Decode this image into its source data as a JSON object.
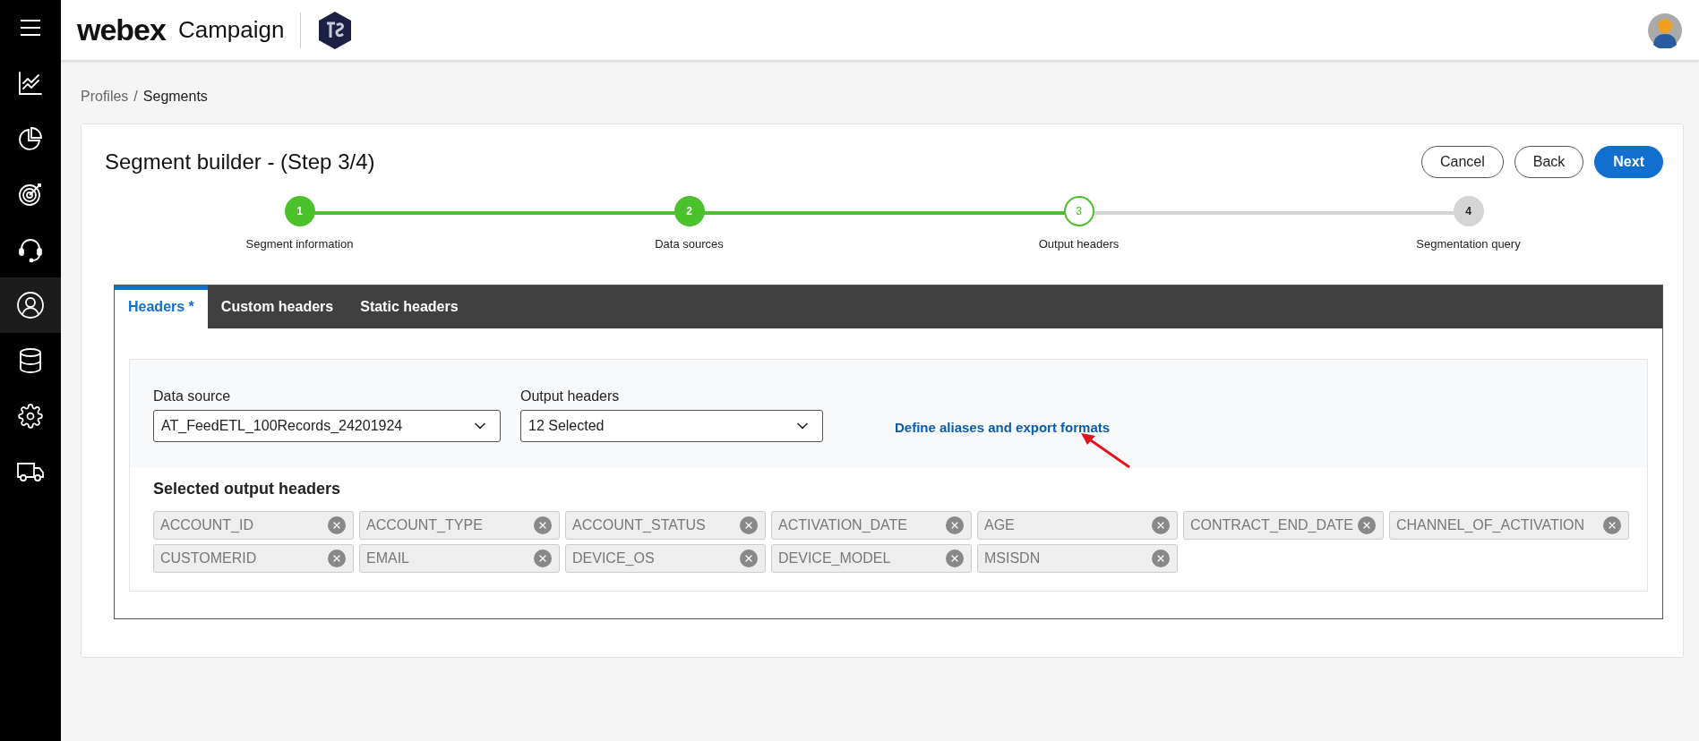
{
  "app": {
    "brand": "webex",
    "product": "Campaign"
  },
  "sidebar": {
    "items": [
      {
        "selected": false
      },
      {
        "selected": false
      },
      {
        "selected": false
      },
      {
        "selected": false
      },
      {
        "selected": true
      },
      {
        "selected": false
      },
      {
        "selected": false
      },
      {
        "selected": false
      }
    ]
  },
  "breadcrumb": {
    "separator": "/",
    "items": [
      {
        "label": "Profiles",
        "current": false
      },
      {
        "label": "Segments",
        "current": true
      }
    ]
  },
  "page_title": "Segment builder - (Step 3/4)",
  "buttons": [
    {
      "label": "Cancel",
      "kind": "outline"
    },
    {
      "label": "Back",
      "kind": "outline"
    },
    {
      "label": "Next",
      "kind": "primary"
    }
  ],
  "steps": [
    {
      "number": "1",
      "label": "Segment information",
      "completed": true,
      "selected": false
    },
    {
      "number": "2",
      "label": "Data sources",
      "completed": true,
      "selected": false
    },
    {
      "number": "3",
      "label": "Output headers",
      "completed": false,
      "selected": true
    },
    {
      "number": "4",
      "label": "Segmentation query",
      "completed": false,
      "selected": false
    }
  ],
  "tabs": [
    {
      "label": "Headers *",
      "selected": true
    },
    {
      "label": "Custom headers",
      "selected": false
    },
    {
      "label": "Static headers",
      "selected": false
    }
  ],
  "form": {
    "data_source": {
      "label": "Data source",
      "value": "AT_FeedETL_100Records_24201924"
    },
    "output_headers": {
      "label": "Output headers",
      "value": "12 Selected"
    },
    "link": "Define aliases and export formats"
  },
  "selected_headers": {
    "title": "Selected output headers",
    "chips": [
      "ACCOUNT_ID",
      "ACCOUNT_TYPE",
      "ACCOUNT_STATUS",
      "ACTIVATION_DATE",
      "AGE",
      "CONTRACT_END_DATE",
      "CHANNEL_OF_ACTIVATION",
      "CUSTOMERID",
      "EMAIL",
      "DEVICE_OS",
      "DEVICE_MODEL",
      "MSISDN"
    ]
  }
}
